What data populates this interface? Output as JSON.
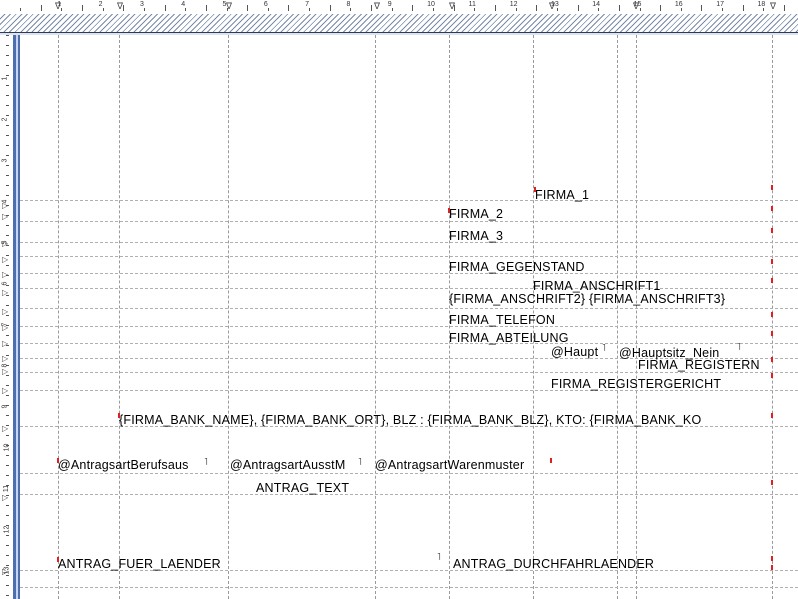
{
  "ruler_top": {
    "numbers": [
      "1",
      "2",
      "3",
      "4",
      "5",
      "6",
      "7",
      "8",
      "9",
      "10",
      "11",
      "12",
      "13",
      "14",
      "15",
      "16",
      "17",
      "18"
    ]
  },
  "ruler_left": {
    "numbers": [
      "1",
      "2",
      "3",
      "4",
      "5",
      "6",
      "7",
      "8",
      "9",
      "10",
      "11",
      "12",
      "13"
    ]
  },
  "fields": [
    {
      "id": "firma-1",
      "text": "FIRMA_1"
    },
    {
      "id": "firma-2",
      "text": "FIRMA_2"
    },
    {
      "id": "firma-3",
      "text": "FIRMA_3"
    },
    {
      "id": "firma-gegenstand",
      "text": "FIRMA_GEGENSTAND"
    },
    {
      "id": "firma-anschrift1",
      "text": "FIRMA_ANSCHRIFT1"
    },
    {
      "id": "firma-anschrift2-3",
      "text": "{FIRMA_ANSCHRIFT2} {FIRMA_ANSCHRIFT3}"
    },
    {
      "id": "firma-telefon",
      "text": "FIRMA_TELEFON"
    },
    {
      "id": "firma-abteilung",
      "text": "FIRMA_ABTEILUNG"
    },
    {
      "id": "haupt",
      "text": "@Haupt"
    },
    {
      "id": "hauptsitz-nein",
      "text": "@Hauptsitz_Nein"
    },
    {
      "id": "firma-registern",
      "text": "FIRMA_REGISTERN"
    },
    {
      "id": "firma-registergericht",
      "text": "FIRMA_REGISTERGERICHT"
    },
    {
      "id": "firma-bank",
      "text": "{FIRMA_BANK_NAME}, {FIRMA_BANK_ORT}, BLZ : {FIRMA_BANK_BLZ}, KTO: {FIRMA_BANK_KO"
    },
    {
      "id": "antragsart-berufsaus",
      "text": "@AntragsartBerufsaus"
    },
    {
      "id": "antragsart-ausstm",
      "text": "@AntragsartAusstM"
    },
    {
      "id": "antragsart-warenmuster",
      "text": "@AntragsartWarenmuster"
    },
    {
      "id": "antrag-text",
      "text": "ANTRAG_TEXT"
    },
    {
      "id": "antrag-fuer-laender",
      "text": "ANTRAG_FUER_LAENDER"
    },
    {
      "id": "antrag-durchfahrlaender",
      "text": "ANTRAG_DURCHFAHRLAENDER"
    }
  ]
}
